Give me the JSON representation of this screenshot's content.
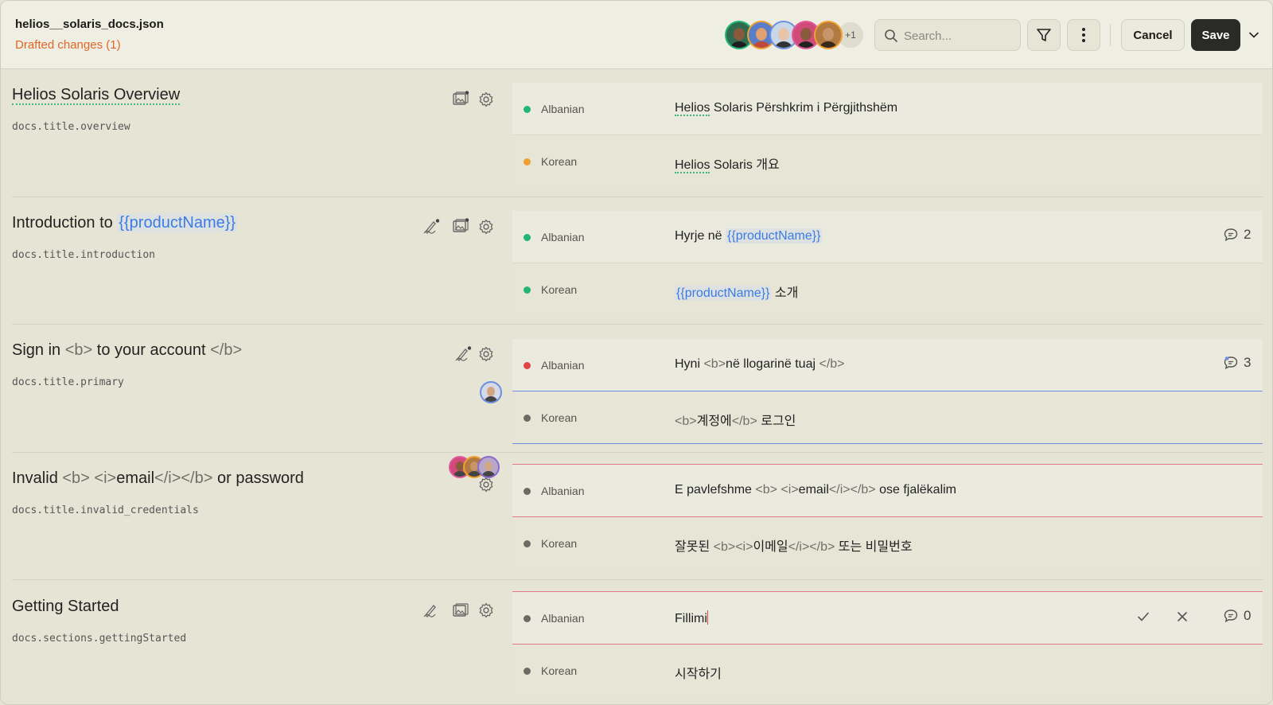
{
  "header": {
    "file_name": "helios__solaris_docs.json",
    "drafted": "Drafted changes (1)",
    "avatars_more": "+1",
    "search_placeholder": "Search...",
    "cancel_label": "Cancel",
    "save_label": "Save"
  },
  "rows": [
    {
      "title": "Helios Solaris Overview",
      "key": "docs.title.overview",
      "albanian": {
        "name": "Albanian",
        "text": "Helios Solaris Përshkrim i Përgjithshëm",
        "status_color": "#22b573"
      },
      "korean": {
        "name": "Korean",
        "text": "Helios Solaris 개요",
        "status_color": "#f0a030"
      }
    },
    {
      "title_prefix": "Introduction to ",
      "title_placeholder": "{{productName}}",
      "key": "docs.title.introduction",
      "albanian": {
        "name": "Albanian",
        "text_prefix": "Hyrje në ",
        "placeholder": "{{productName}}",
        "status_color": "#22b573",
        "comments": "2"
      },
      "korean": {
        "name": "Korean",
        "placeholder": "{{productName}}",
        "text_suffix": " 소개",
        "status_color": "#22b573"
      }
    },
    {
      "title_a": "Sign in ",
      "title_tag1": "<b>",
      "title_b": " to your account ",
      "title_tag2": "</b>",
      "key": "docs.title.primary",
      "albanian": {
        "name": "Albanian",
        "text_a": "Hyni ",
        "tag1": "<b>",
        "text_b": "në llogarinë tuaj ",
        "tag2": "</b>",
        "status_color": "#e04444",
        "comments": "3"
      },
      "korean": {
        "name": "Korean",
        "tag1": "<b>",
        "text_a": "계정에",
        "tag2": "</b>",
        "text_b": " 로그인",
        "status_color": "#6b6b63"
      }
    },
    {
      "title_a": "Invalid ",
      "title_tag1": "<b> <i>",
      "title_b": "email",
      "title_tag2": "</i></b>",
      "title_c": " or password",
      "key": "docs.title.invalid_credentials",
      "albanian": {
        "name": "Albanian",
        "text_a": "E pavlefshme ",
        "tag1": "<b> <i>",
        "text_b": "email",
        "tag2": "</i></b>",
        "text_c": " ose fjalëkalim",
        "status_color": "#6b6b63"
      },
      "korean": {
        "name": "Korean",
        "text_a": "잘못된 ",
        "tag1": "<b><i>",
        "text_b": "이메일",
        "tag2": "</i></b>",
        "text_c": " 또는 비밀번호",
        "status_color": "#6b6b63"
      }
    },
    {
      "title": "Getting Started",
      "key": "docs.sections.gettingStarted",
      "albanian": {
        "name": "Albanian",
        "text": "Fillimi",
        "status_color": "#6b6b63",
        "comments": "0"
      },
      "korean": {
        "name": "Korean",
        "text": "시작하기",
        "status_color": "#6b6b63"
      }
    }
  ]
}
